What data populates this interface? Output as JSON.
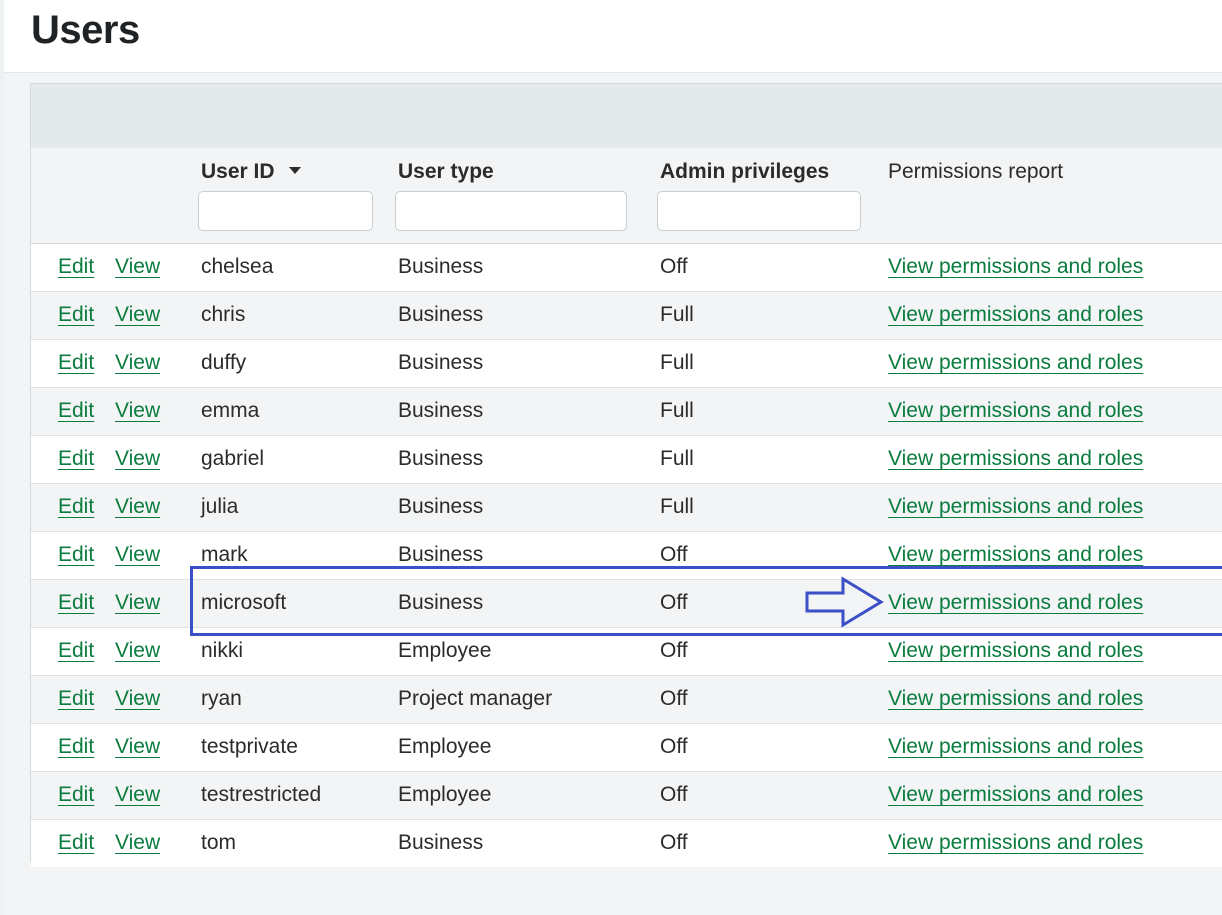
{
  "page": {
    "title": "Users"
  },
  "columns": {
    "user_id": "User ID",
    "user_type": "User type",
    "admin": "Admin privileges",
    "permissions": "Permissions report"
  },
  "filters": {
    "user_id": "",
    "user_type": "",
    "admin": ""
  },
  "row_actions": {
    "edit": "Edit",
    "view": "View",
    "permissions_link": "View permissions and roles"
  },
  "rows": [
    {
      "user_id": "chelsea",
      "user_type": "Business",
      "admin": "Off"
    },
    {
      "user_id": "chris",
      "user_type": "Business",
      "admin": "Full"
    },
    {
      "user_id": "duffy",
      "user_type": "Business",
      "admin": "Full"
    },
    {
      "user_id": "emma",
      "user_type": "Business",
      "admin": "Full"
    },
    {
      "user_id": "gabriel",
      "user_type": "Business",
      "admin": "Full"
    },
    {
      "user_id": "julia",
      "user_type": "Business",
      "admin": "Full"
    },
    {
      "user_id": "mark",
      "user_type": "Business",
      "admin": "Off"
    },
    {
      "user_id": "microsoft",
      "user_type": "Business",
      "admin": "Off"
    },
    {
      "user_id": "nikki",
      "user_type": "Employee",
      "admin": "Off"
    },
    {
      "user_id": "ryan",
      "user_type": "Project manager",
      "admin": "Off"
    },
    {
      "user_id": "testprivate",
      "user_type": "Employee",
      "admin": "Off"
    },
    {
      "user_id": "testrestricted",
      "user_type": "Employee",
      "admin": "Off"
    },
    {
      "user_id": "tom",
      "user_type": "Business",
      "admin": "Off"
    }
  ],
  "annotation": {
    "highlight_color": "#3b4fc6",
    "highlighted_user": "microsoft"
  },
  "colors": {
    "link": "#0a7c3e",
    "header_bg": "#f2f4f5",
    "toolbar_bg": "#e4e9eb"
  },
  "icons": {
    "sort": "sort-descending-icon",
    "annotation_arrow": "arrow-right-icon"
  }
}
